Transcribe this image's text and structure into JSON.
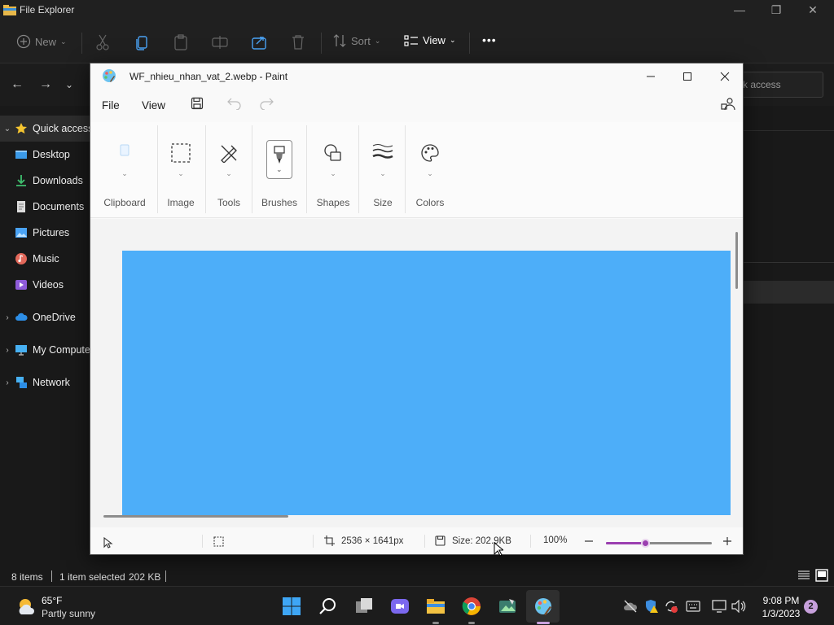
{
  "explorer": {
    "title": "File Explorer",
    "cmd": {
      "new": "New",
      "sort": "Sort",
      "view": "View",
      "more": "•••"
    },
    "search_placeholder": "k access",
    "sidebar": [
      {
        "label": "Quick access",
        "icon": "star-icon"
      },
      {
        "label": "Desktop",
        "icon": "desktop-folder-icon"
      },
      {
        "label": "Downloads",
        "icon": "download-icon"
      },
      {
        "label": "Documents",
        "icon": "document-icon"
      },
      {
        "label": "Pictures",
        "icon": "pictures-icon"
      },
      {
        "label": "Music",
        "icon": "music-icon"
      },
      {
        "label": "Videos",
        "icon": "videos-icon"
      },
      {
        "label": "OneDrive",
        "icon": "cloud-icon"
      },
      {
        "label": "My Computer",
        "icon": "computer-icon"
      },
      {
        "label": "Network",
        "icon": "network-icon"
      }
    ],
    "status": {
      "items": "8 items",
      "selected": "1 item selected",
      "size": "202 KB"
    }
  },
  "paint": {
    "title": "WF_nhieu_nhan_vat_2.webp - Paint",
    "menu": {
      "file": "File",
      "view": "View"
    },
    "ribbon": {
      "clipboard": "Clipboard",
      "image": "Image",
      "tools": "Tools",
      "brushes": "Brushes",
      "shapes": "Shapes",
      "size": "Size",
      "colors": "Colors"
    },
    "canvas_color": "#4daef9",
    "status": {
      "dimensions": "2536 × 1641px",
      "filesize": "Size: 202.9KB",
      "zoom": "100%",
      "zoom_fraction": 0.38
    }
  },
  "taskbar": {
    "weather_temp": "65°F",
    "weather_desc": "Partly sunny",
    "time": "9:08 PM",
    "date": "1/3/2023",
    "notification_count": "2"
  }
}
